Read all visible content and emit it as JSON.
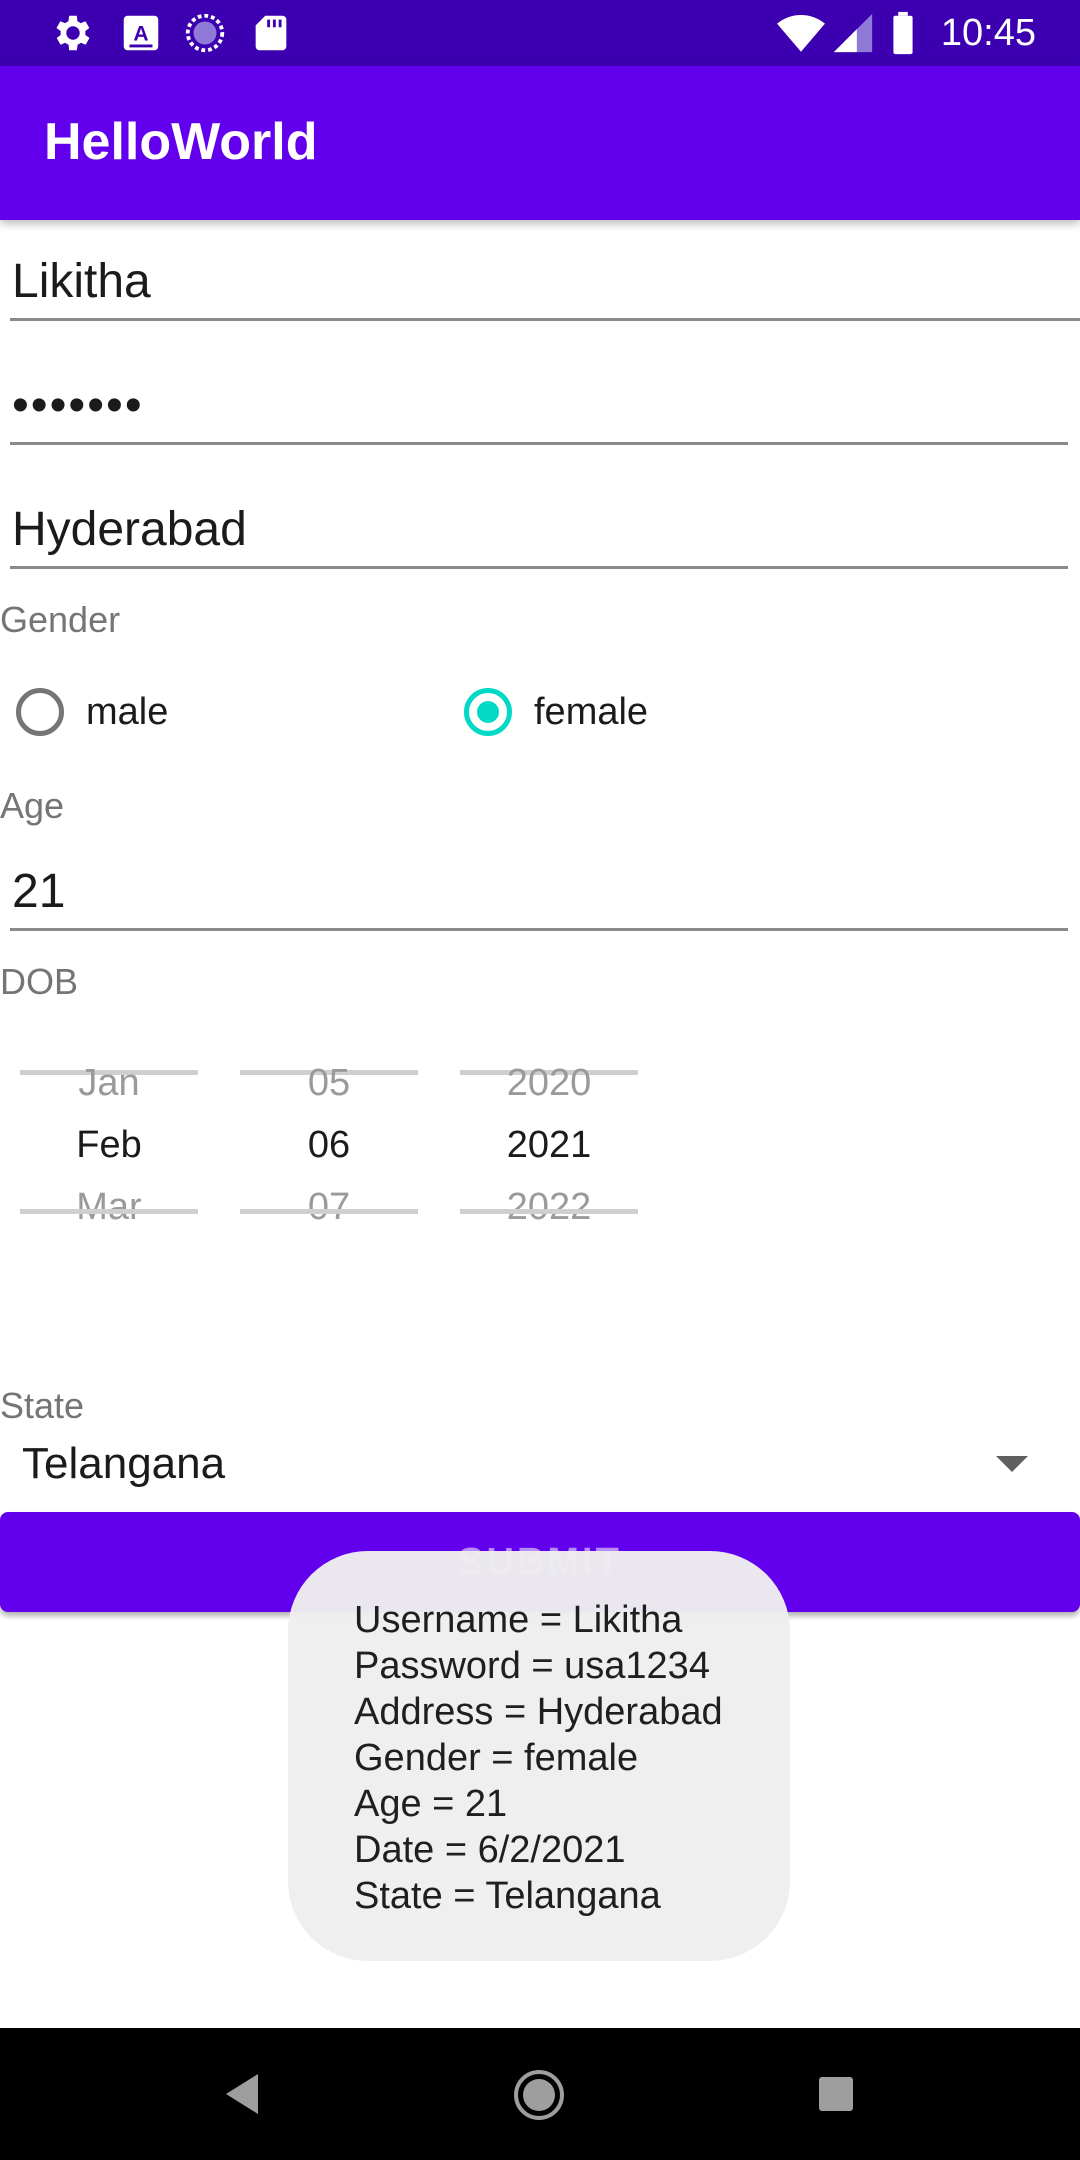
{
  "status_bar": {
    "time": "10:45",
    "icons_left": [
      "gear-icon",
      "a-icon",
      "spinner-icon",
      "sd-card-icon"
    ],
    "icons_right": [
      "wifi-icon",
      "signal-icon",
      "battery-icon"
    ]
  },
  "app_bar": {
    "title": "HelloWorld"
  },
  "form": {
    "username_value": "Likitha",
    "password_value": "•••••••",
    "address_value": "Hyderabad",
    "gender_label": "Gender",
    "gender_options": [
      {
        "label": "male",
        "checked": false
      },
      {
        "label": "female",
        "checked": true
      }
    ],
    "age_label": "Age",
    "age_value": "21",
    "dob_label": "DOB",
    "dob_picker": {
      "month": {
        "prev": "Jan",
        "selected": "Feb",
        "next": "Mar"
      },
      "day": {
        "prev": "05",
        "selected": "06",
        "next": "07"
      },
      "year": {
        "prev": "2020",
        "selected": "2021",
        "next": "2022"
      }
    },
    "state_label": "State",
    "state_value": "Telangana",
    "submit_label": "SUBMIT"
  },
  "toast": {
    "lines": [
      "Username = Likitha",
      "Password = usa1234",
      "Address = Hyderabad",
      "Gender = female",
      "Age = 21",
      "Date = 6/2/2021",
      "State = Telangana"
    ]
  },
  "colors": {
    "status_bar": "#3c00b0",
    "primary": "#6200ee",
    "accent": "#03dac5"
  }
}
